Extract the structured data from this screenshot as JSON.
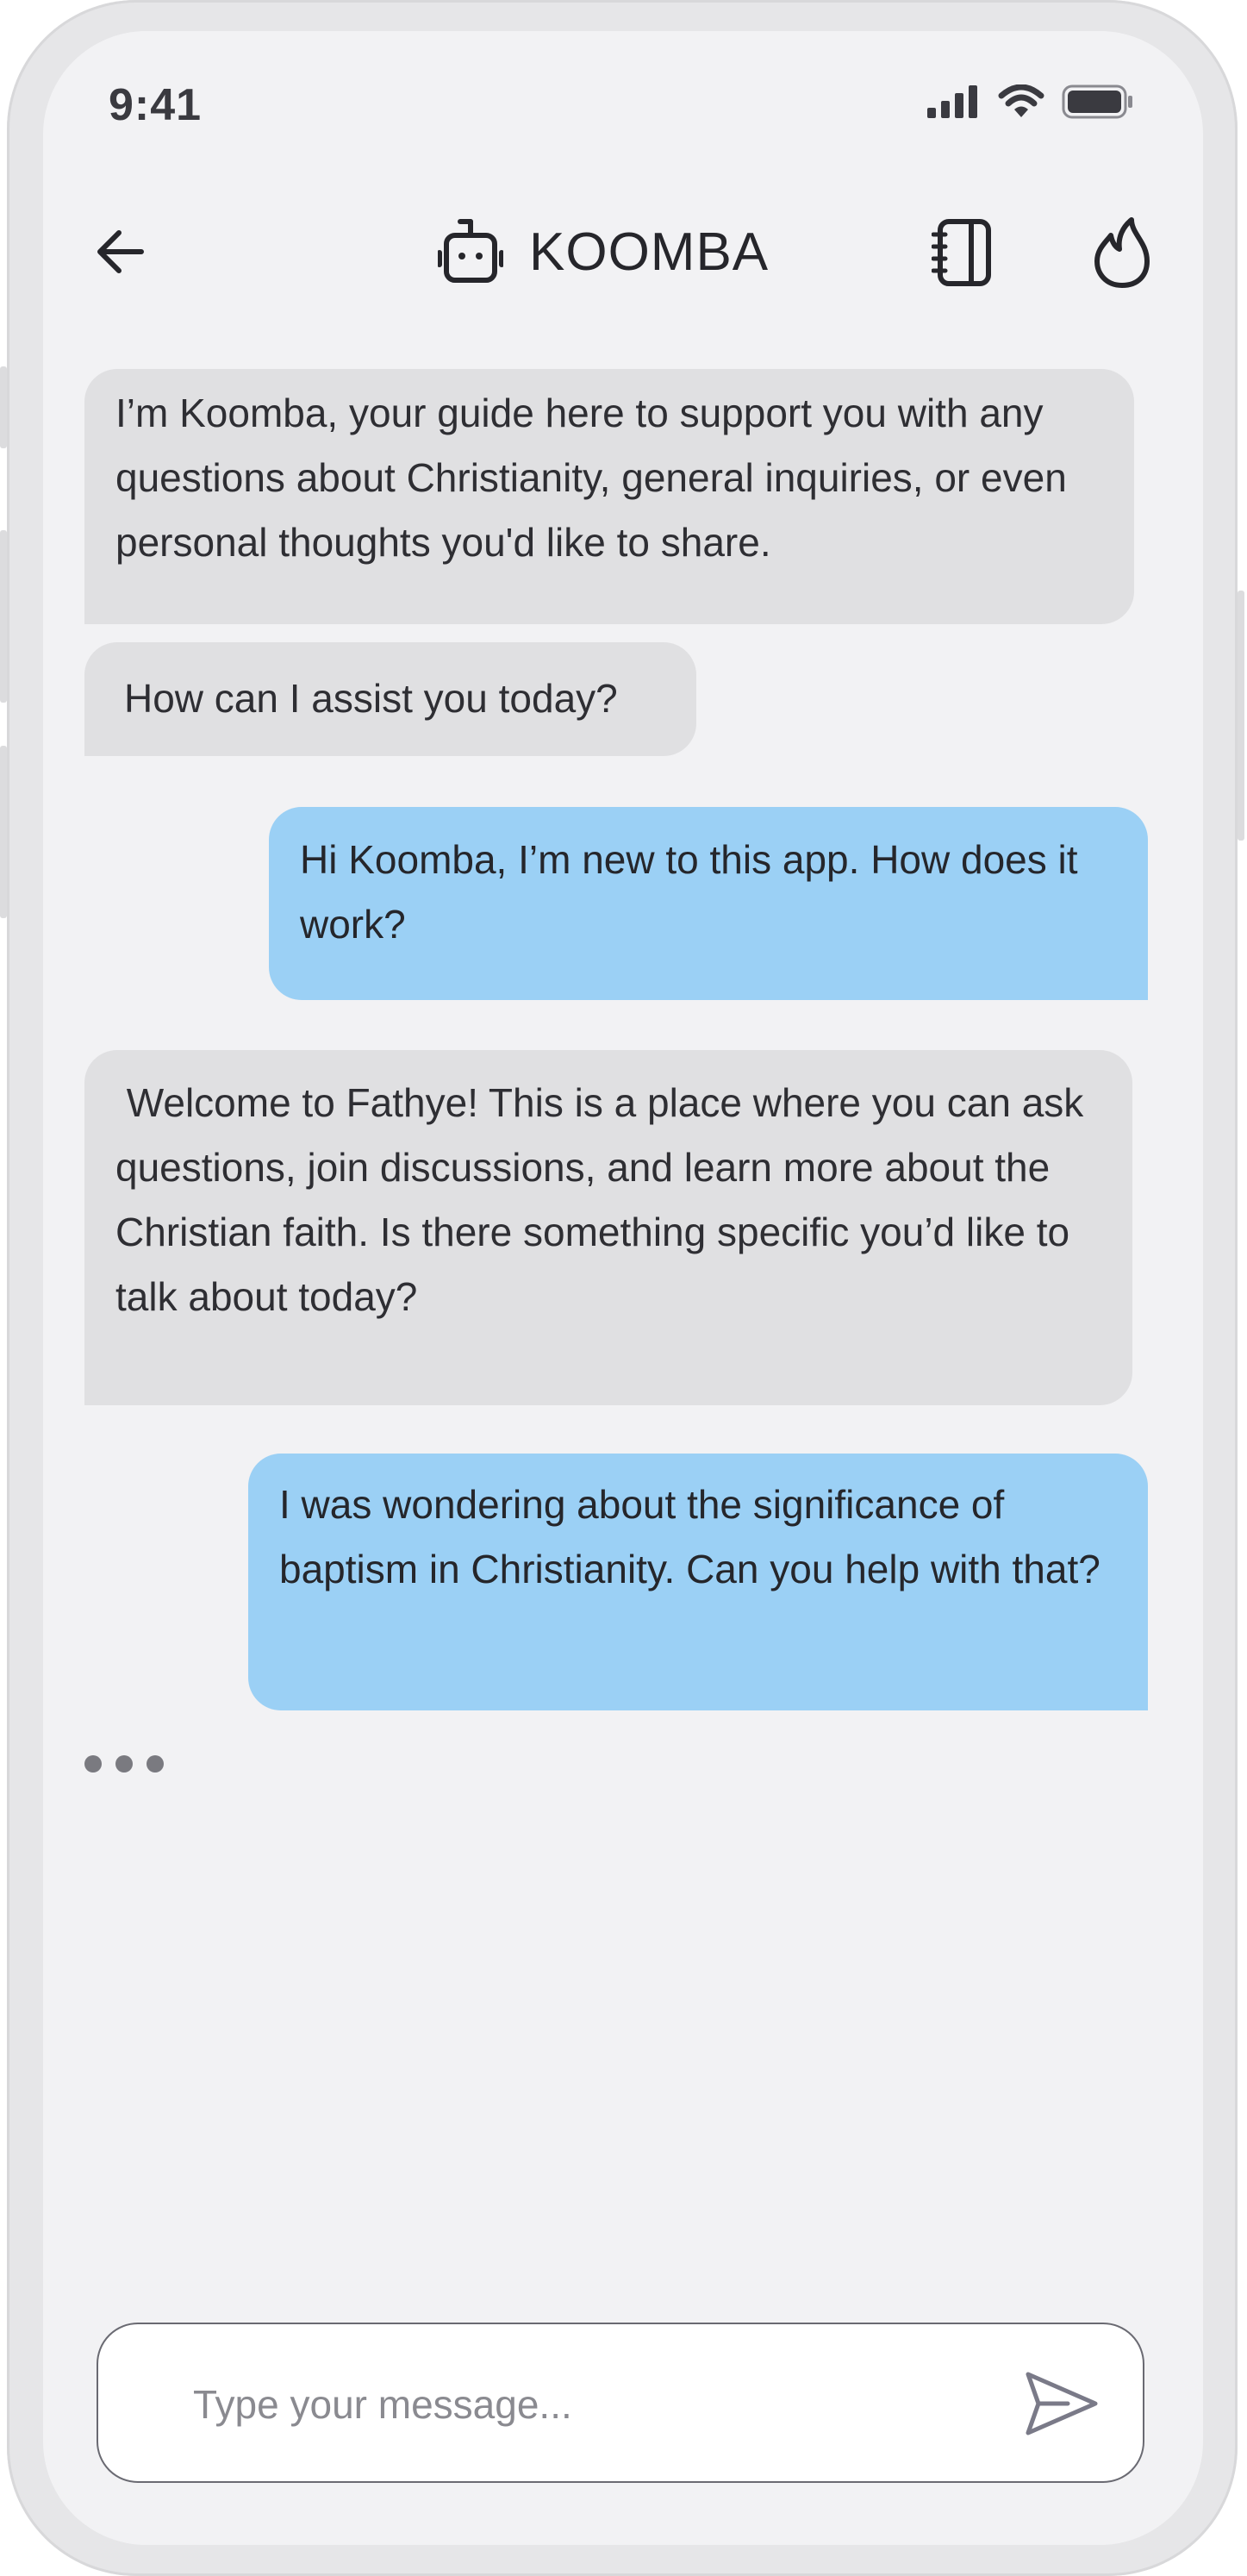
{
  "status_bar": {
    "time": "9:41"
  },
  "header": {
    "title": "KOOMBA",
    "icons": {
      "back": "arrow-left-icon",
      "bot": "robot-icon",
      "notebook": "notebook-icon",
      "flame": "flame-icon"
    }
  },
  "messages": [
    {
      "sender": "bot",
      "text": "I’m Koomba, your guide here to support you with any questions about Christianity, general inquiries, or even personal thoughts you'd like to share."
    },
    {
      "sender": "bot",
      "text": "How can I assist you today?"
    },
    {
      "sender": "user",
      "text": "Hi Koomba, I’m new to this app. How does it work?"
    },
    {
      "sender": "bot",
      "text": " Welcome to Fathye! This is a place where you can ask questions, join discussions, and learn more about the Christian faith. Is there something specific you’d like to talk about today?"
    },
    {
      "sender": "user",
      "text": "I was wondering about the significance of baptism in Christianity. Can you help with that?"
    }
  ],
  "composer": {
    "placeholder": "Type your message...",
    "value": ""
  },
  "colors": {
    "bot_bubble": "#e0e0e2",
    "user_bubble": "#9bd0f5",
    "background": "#f2f2f4"
  }
}
